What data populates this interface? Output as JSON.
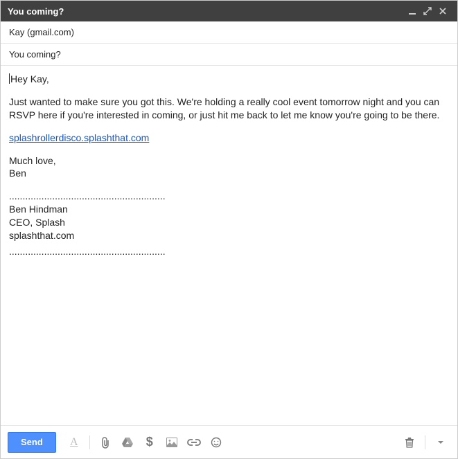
{
  "titlebar": {
    "title": "You coming?"
  },
  "fields": {
    "to": "Kay (gmail.com)",
    "subject": "You coming?"
  },
  "body": {
    "greeting": "Hey Kay,",
    "para1": "Just wanted to make sure you got this. We're holding a really cool event tomorrow night and you can RSVP here if you're interested in coming, or just hit me back to let me know you're going to be there.",
    "link_text": "splashrollerdisco.splashthat.com",
    "signoff1": "Much love,",
    "signoff2": "Ben",
    "sig_divider": "..........................................................",
    "sig_name": "Ben Hindman",
    "sig_title": "CEO, Splash",
    "sig_site": "splashthat.com"
  },
  "toolbar": {
    "send_label": "Send",
    "format_glyph": "A",
    "dollar_glyph": "$"
  }
}
